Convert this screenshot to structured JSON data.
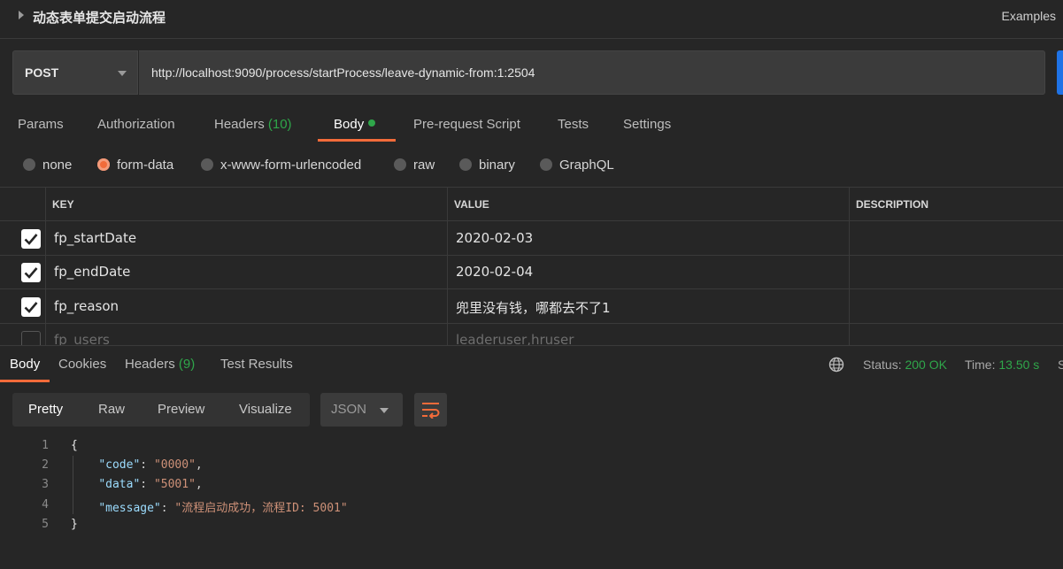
{
  "title": "动态表单提交启动流程",
  "examples": "Examples",
  "request": {
    "method": "POST",
    "url": "http://localhost:9090/process/startProcess/leave-dynamic-from:1:2504"
  },
  "request_tabs": {
    "params": "Params",
    "authorization": "Authorization",
    "headers": "Headers",
    "headers_count": "(10)",
    "body": "Body",
    "prerequest": "Pre-request Script",
    "tests": "Tests",
    "settings": "Settings"
  },
  "body_types": {
    "none": "none",
    "form_data": "form-data",
    "urlencoded": "x-www-form-urlencoded",
    "raw": "raw",
    "binary": "binary",
    "graphql": "GraphQL",
    "selected": "form-data"
  },
  "table": {
    "headers": {
      "key": "KEY",
      "value": "VALUE",
      "description": "DESCRIPTION"
    },
    "rows": [
      {
        "checked": true,
        "key": "fp_startDate",
        "value": "2020-02-03",
        "description": ""
      },
      {
        "checked": true,
        "key": "fp_endDate",
        "value": "2020-02-04",
        "description": ""
      },
      {
        "checked": true,
        "key": "fp_reason",
        "value": "兜里没有钱，哪都去不了1",
        "description": ""
      },
      {
        "checked": false,
        "key": "fp_users",
        "value": "leaderuser,hruser",
        "description": ""
      }
    ]
  },
  "response_tabs": {
    "body": "Body",
    "cookies": "Cookies",
    "headers": "Headers",
    "headers_count": "(9)",
    "test_results": "Test Results"
  },
  "status": {
    "status_label": "Status:",
    "status_value": "200 OK",
    "time_label": "Time:",
    "time_value": "13.50 s",
    "size_label": "S"
  },
  "view_modes": {
    "pretty": "Pretty",
    "raw": "Raw",
    "preview": "Preview",
    "visualize": "Visualize",
    "format": "JSON"
  },
  "response_code": {
    "line_numbers": [
      "1",
      "2",
      "3",
      "4",
      "5"
    ],
    "open_brace": "{",
    "close_brace": "}",
    "k_code": "\"code\"",
    "v_code": "\"0000\"",
    "k_data": "\"data\"",
    "v_data": "\"5001\"",
    "k_message": "\"message\"",
    "v_message": "\"流程启动成功，流程ID: 5001\""
  },
  "colors": {
    "accent": "#f26b3a",
    "success": "#2fa64a",
    "send": "#1f73e6"
  }
}
